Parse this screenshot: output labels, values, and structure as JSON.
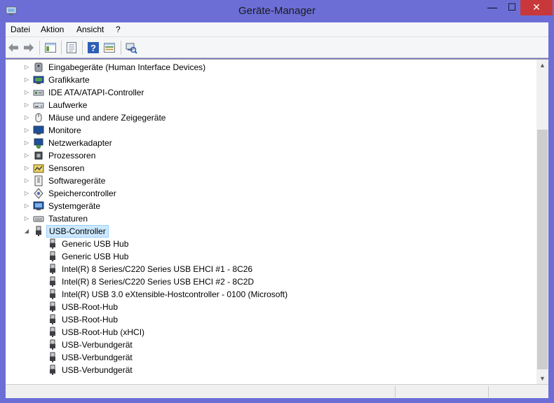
{
  "window": {
    "title": "Geräte-Manager",
    "minimize": "—",
    "maximize": "☐",
    "close": "✕"
  },
  "menu": [
    "Datei",
    "Aktion",
    "Ansicht",
    "?"
  ],
  "toolbar": [
    "back-icon",
    "forward-icon",
    "show-hide-tree-icon",
    "properties-icon",
    "help-icon",
    "view-icon",
    "scan-hardware-icon"
  ],
  "tree": {
    "categories": [
      {
        "label": "Eingabegeräte (Human Interface Devices)",
        "icon": "hid-icon",
        "expanded": false
      },
      {
        "label": "Grafikkarte",
        "icon": "display-adapter-icon",
        "expanded": false
      },
      {
        "label": "IDE ATA/ATAPI-Controller",
        "icon": "ide-controller-icon",
        "expanded": false
      },
      {
        "label": "Laufwerke",
        "icon": "disk-drive-icon",
        "expanded": false
      },
      {
        "label": "Mäuse und andere Zeigegeräte",
        "icon": "mouse-icon",
        "expanded": false
      },
      {
        "label": "Monitore",
        "icon": "monitor-icon",
        "expanded": false
      },
      {
        "label": "Netzwerkadapter",
        "icon": "network-adapter-icon",
        "expanded": false
      },
      {
        "label": "Prozessoren",
        "icon": "processor-icon",
        "expanded": false
      },
      {
        "label": "Sensoren",
        "icon": "sensor-icon",
        "expanded": false
      },
      {
        "label": "Softwaregeräte",
        "icon": "software-device-icon",
        "expanded": false
      },
      {
        "label": "Speichercontroller",
        "icon": "storage-controller-icon",
        "expanded": false
      },
      {
        "label": "Systemgeräte",
        "icon": "system-device-icon",
        "expanded": false
      },
      {
        "label": "Tastaturen",
        "icon": "keyboard-icon",
        "expanded": false
      },
      {
        "label": "USB-Controller",
        "icon": "usb-icon",
        "expanded": true,
        "selected": true
      }
    ],
    "usb_children": [
      "Generic USB Hub",
      "Generic USB Hub",
      "Intel(R) 8 Series/C220 Series  USB EHCI #1 - 8C26",
      "Intel(R) 8 Series/C220 Series  USB EHCI #2 - 8C2D",
      "Intel(R) USB 3.0 eXtensible-Hostcontroller - 0100 (Microsoft)",
      "USB-Root-Hub",
      "USB-Root-Hub",
      "USB-Root-Hub (xHCI)",
      "USB-Verbundgerät",
      "USB-Verbundgerät",
      "USB-Verbundgerät"
    ]
  },
  "colors": {
    "titlebar": "#6c6ed6",
    "close": "#c8383a",
    "selection": "#cce8ff"
  }
}
